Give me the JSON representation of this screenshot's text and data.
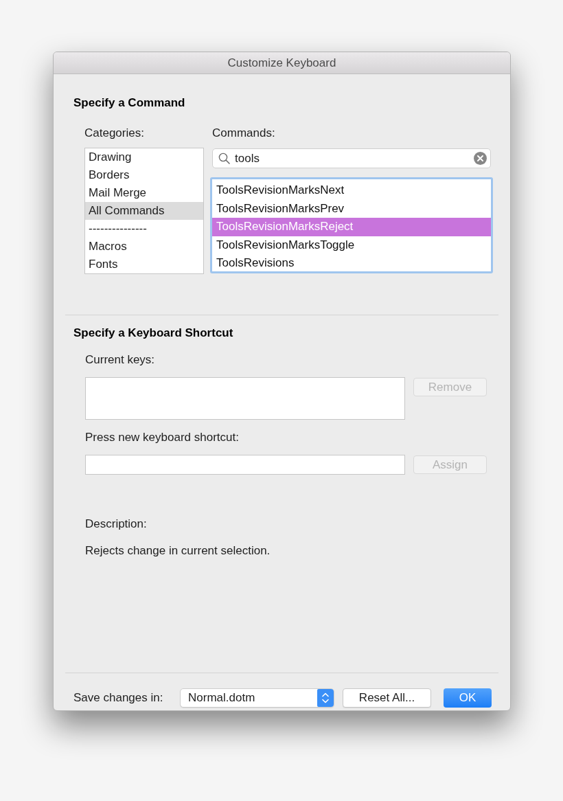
{
  "window": {
    "title": "Customize Keyboard"
  },
  "command_section": {
    "heading": "Specify a Command",
    "categories": {
      "label": "Categories:",
      "items": [
        {
          "label": "Drawing",
          "selected": false
        },
        {
          "label": "Borders",
          "selected": false
        },
        {
          "label": "Mail Merge",
          "selected": false
        },
        {
          "label": "All Commands",
          "selected": true
        },
        {
          "label": "---------------",
          "selected": false
        },
        {
          "label": "Macros",
          "selected": false
        },
        {
          "label": "Fonts",
          "selected": false
        }
      ]
    },
    "commands": {
      "label": "Commands:",
      "search": {
        "value": "tools"
      },
      "focused": true,
      "items": [
        {
          "label": "ToolsRevisionMarksNext",
          "selected": false
        },
        {
          "label": "ToolsRevisionMarksPrev",
          "selected": false
        },
        {
          "label": "ToolsRevisionMarksReject",
          "selected": true
        },
        {
          "label": "ToolsRevisionMarksToggle",
          "selected": false
        },
        {
          "label": "ToolsRevisions",
          "selected": false
        }
      ]
    }
  },
  "shortcut_section": {
    "heading": "Specify a Keyboard Shortcut",
    "current_keys_label": "Current keys:",
    "remove_button": {
      "label": "Remove",
      "disabled": true
    },
    "new_shortcut_label": "Press new keyboard shortcut:",
    "assign_button": {
      "label": "Assign",
      "disabled": true
    },
    "description_label": "Description:",
    "description": "Rejects change in current selection."
  },
  "footer": {
    "save_label": "Save changes in:",
    "save_in": {
      "value": "Normal.dotm"
    },
    "buttons": [
      {
        "label": "Reset All...",
        "kind": "secondary"
      },
      {
        "label": "OK",
        "kind": "default"
      }
    ]
  }
}
